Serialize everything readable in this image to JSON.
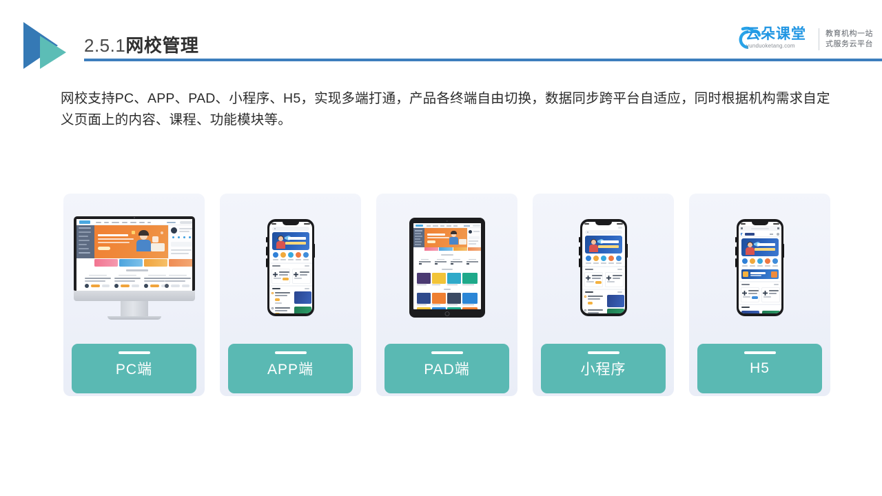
{
  "header": {
    "title_number": "2.5.1",
    "title_name": "网校管理",
    "logo_icon": "play-triangle-logo",
    "brand": {
      "name": "云朵课堂",
      "url": "yunduoketang.com",
      "tagline_line1": "教育机构一站",
      "tagline_line2": "式服务云平台",
      "cloud_icon": "cloud-icon"
    },
    "rule_color": "#3d7ebd"
  },
  "intro": {
    "paragraph": "网校支持PC、APP、PAD、小程序、H5，实现多端打通，产品各终端自由切换，数据同步跨平台自适应，同时根据机构需求自定义页面上的内容、课程、功能模块等。"
  },
  "colors": {
    "accent_teal": "#5ab9b3",
    "accent_blue": "#3d7ebd",
    "card_bg_top": "#f3f5fb",
    "card_bg_bottom": "#e9edf7",
    "hero_orange": "#f07f32",
    "hero_blue": "#2b63bd"
  },
  "cards": [
    {
      "label": "PC端",
      "device": "imac",
      "device_icon": "desktop-monitor-icon"
    },
    {
      "label": "APP端",
      "device": "iphone",
      "device_icon": "smartphone-icon"
    },
    {
      "label": "PAD端",
      "device": "ipad",
      "device_icon": "tablet-icon"
    },
    {
      "label": "小程序",
      "device": "iphone",
      "device_icon": "smartphone-icon"
    },
    {
      "label": "H5",
      "device": "iphone",
      "device_icon": "smartphone-browser-icon"
    }
  ]
}
